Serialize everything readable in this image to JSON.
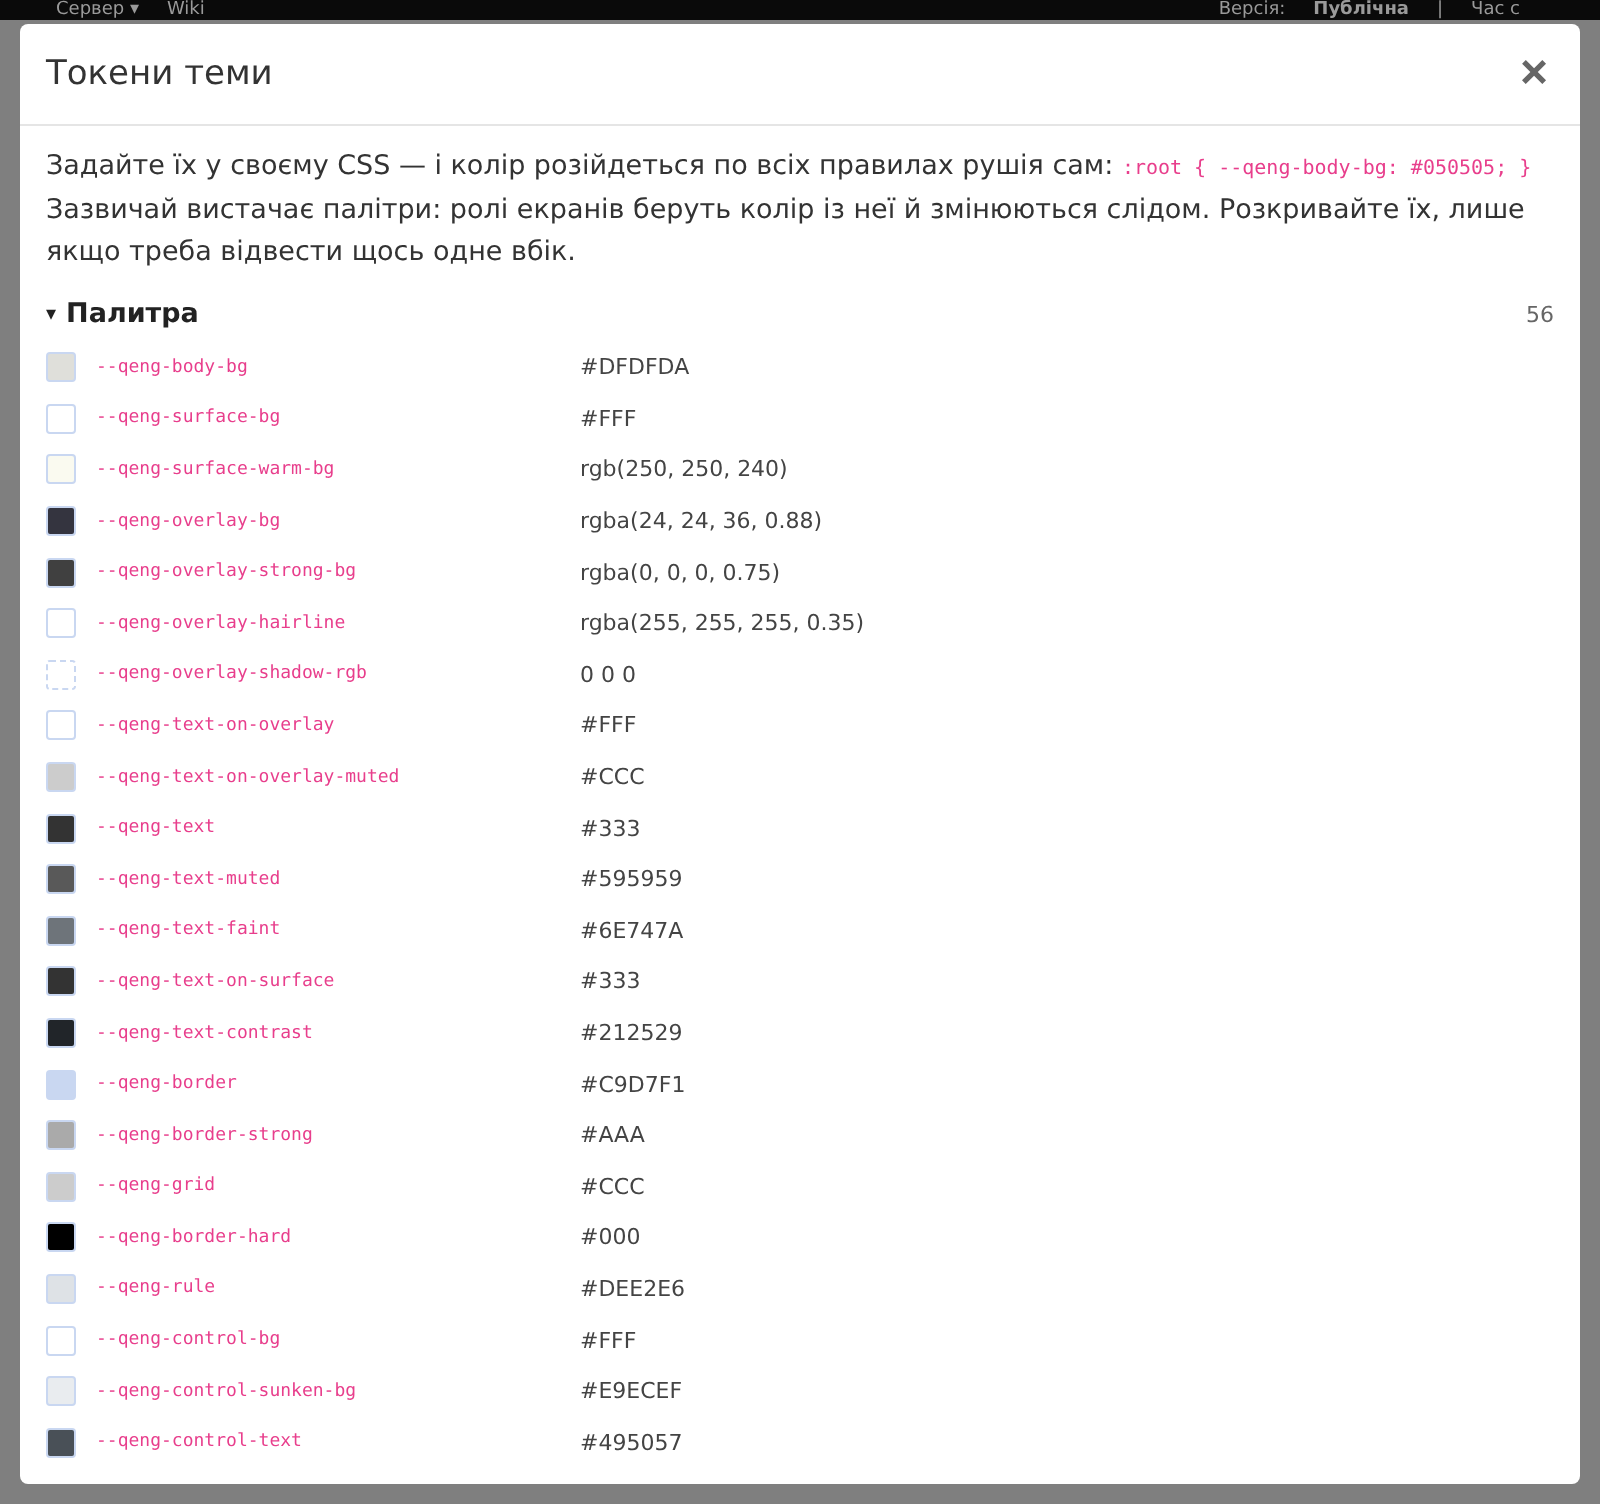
{
  "background_bar": {
    "left_items": [
      "Сервер ▾",
      "Wiki"
    ],
    "right_items": [
      "Версія:",
      "Публічна",
      "|",
      "Час с"
    ]
  },
  "dialog": {
    "title": "Токени теми",
    "close": "×",
    "intro": {
      "text": "Задайте їх у своєму CSS — і колір розійдеться по всіх правилах рушія сам:",
      "code": ":root { --qeng-body-bg: #050505; }"
    },
    "note": "Зазвичай вистачає палітри: ролі екранів беруть колір із неї й змінюються слідом. Розкривайте їх, лише якщо треба відвести щось одне вбік.",
    "section": {
      "title": "Палитра",
      "marker": "▾",
      "expanded": true,
      "count": "56",
      "tokens": [
        {
          "name": "--qeng-body-bg",
          "value": "#DFDFDA",
          "kind": "swatch",
          "color": "#dfdfda"
        },
        {
          "name": "--qeng-surface-bg",
          "value": "#FFF",
          "kind": "swatch",
          "color": "#ffffff"
        },
        {
          "name": "--qeng-surface-warm-bg",
          "value": "rgb(250, 250, 240)",
          "kind": "swatch",
          "color": "#fafaf0"
        },
        {
          "name": "--qeng-overlay-bg",
          "value": "rgba(24, 24, 36, 0.88)",
          "kind": "swatch",
          "color": "#34343f"
        },
        {
          "name": "--qeng-overlay-strong-bg",
          "value": "rgba(0, 0, 0, 0.75)",
          "kind": "swatch",
          "color": "#404040"
        },
        {
          "name": "--qeng-overlay-hairline",
          "value": "rgba(255, 255, 255, 0.35)",
          "kind": "swatch",
          "color": "#ffffff"
        },
        {
          "name": "--qeng-overlay-shadow-rgb",
          "value": "0 0 0",
          "kind": "empty"
        },
        {
          "name": "--qeng-text-on-overlay",
          "value": "#FFF",
          "kind": "swatch",
          "color": "#ffffff"
        },
        {
          "name": "--qeng-text-on-overlay-muted",
          "value": "#CCC",
          "kind": "swatch",
          "color": "#cccccc"
        },
        {
          "name": "--qeng-text",
          "value": "#333",
          "kind": "swatch",
          "color": "#333333"
        },
        {
          "name": "--qeng-text-muted",
          "value": "#595959",
          "kind": "swatch",
          "color": "#595959"
        },
        {
          "name": "--qeng-text-faint",
          "value": "#6E747A",
          "kind": "swatch",
          "color": "#6e747a"
        },
        {
          "name": "--qeng-text-on-surface",
          "value": "#333",
          "kind": "swatch",
          "color": "#333333"
        },
        {
          "name": "--qeng-text-contrast",
          "value": "#212529",
          "kind": "swatch",
          "color": "#212529"
        },
        {
          "name": "--qeng-border",
          "value": "#C9D7F1",
          "kind": "swatch",
          "color": "#c9d7f1"
        },
        {
          "name": "--qeng-border-strong",
          "value": "#AAA",
          "kind": "swatch",
          "color": "#aaaaaa"
        },
        {
          "name": "--qeng-grid",
          "value": "#CCC",
          "kind": "swatch",
          "color": "#cccccc"
        },
        {
          "name": "--qeng-border-hard",
          "value": "#000",
          "kind": "swatch",
          "color": "#000000"
        },
        {
          "name": "--qeng-rule",
          "value": "#DEE2E6",
          "kind": "swatch",
          "color": "#dee2e6"
        },
        {
          "name": "--qeng-control-bg",
          "value": "#FFF",
          "kind": "swatch",
          "color": "#ffffff"
        },
        {
          "name": "--qeng-control-sunken-bg",
          "value": "#E9ECEF",
          "kind": "swatch",
          "color": "#e9ecef"
        },
        {
          "name": "--qeng-control-text",
          "value": "#495057",
          "kind": "swatch",
          "color": "#495057"
        }
      ]
    }
  }
}
